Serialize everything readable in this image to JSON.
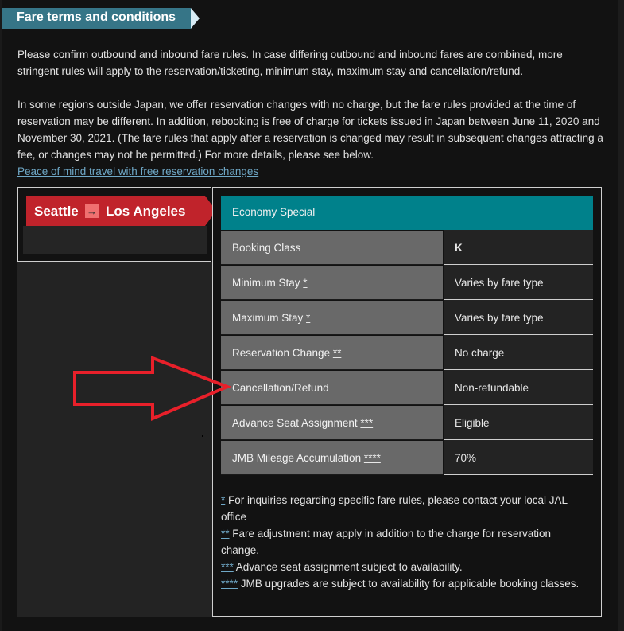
{
  "header": {
    "title": "Fare terms and conditions"
  },
  "intro": {
    "paragraph1": "Please confirm outbound and inbound fare rules. In case differing outbound and inbound fares are combined, more stringent rules will apply to the reservation/ticketing, minimum stay, maximum stay and cancellation/refund.",
    "paragraph2": "In some regions outside Japan, we offer reservation changes with no charge, but the fare rules provided at the time of reservation may be different. In addition, rebooking is free of charge for tickets issued in Japan between June 11, 2020 and November 30, 2021. (The fare rules that apply after a reservation is changed may result in subsequent changes attracting a fee, or changes may not be permitted.) For more details, please see below.",
    "link": "Peace of mind travel with free reservation changes"
  },
  "route": {
    "from": "Seattle",
    "to": "Los Angeles",
    "icon": "arrow-right-icon"
  },
  "fare": {
    "name": "Economy Special",
    "rows": [
      {
        "label": "Booking Class",
        "mark": "",
        "value": "K"
      },
      {
        "label": "Minimum Stay",
        "mark": "*",
        "value": "Varies by fare type"
      },
      {
        "label": "Maximum Stay",
        "mark": "*",
        "value": "Varies by fare type"
      },
      {
        "label": "Reservation Change",
        "mark": "**",
        "value": "No charge"
      },
      {
        "label": "Cancellation/Refund",
        "mark": "",
        "value": "Non-refundable"
      },
      {
        "label": "Advance Seat Assignment",
        "mark": "***",
        "value": "Eligible"
      },
      {
        "label": "JMB Mileage Accumulation",
        "mark": "****",
        "value": "70%"
      }
    ]
  },
  "notes": [
    {
      "mark": "*",
      "text": " For inquiries regarding specific fare rules, please contact your local JAL office"
    },
    {
      "mark": "**",
      "text": " Fare adjustment may apply in addition to the charge for reservation change."
    },
    {
      "mark": "***",
      "text": " Advance seat assignment subject to availability."
    },
    {
      "mark": "****",
      "text": " JMB upgrades are subject to availability for applicable booking classes."
    }
  ],
  "colors": {
    "header": "#367587",
    "route": "#c0232b",
    "fare_header": "#00818b",
    "annotation": "#e8202a",
    "link": "#6fa8c7"
  }
}
